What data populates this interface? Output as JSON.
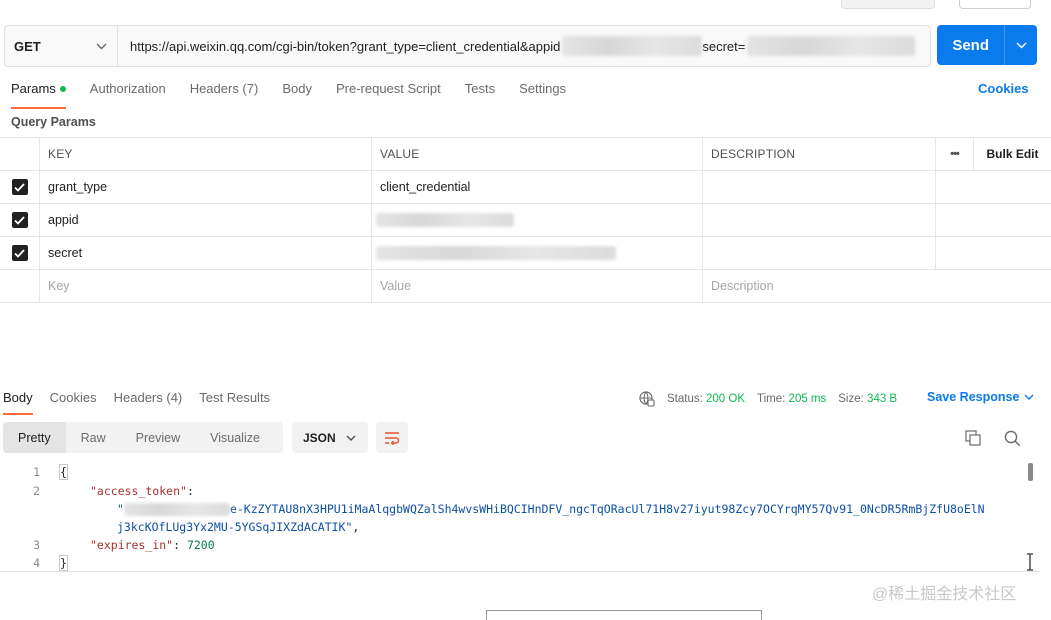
{
  "request": {
    "method": "GET",
    "url_prefix": "https://api.weixin.qq.com/cgi-bin/token?grant_type=client_credential&appid",
    "url_secret_label": "secret=",
    "send_label": "Send"
  },
  "request_tabs": [
    {
      "label": "Params",
      "active": true
    },
    {
      "label": "Authorization"
    },
    {
      "label": "Headers (7)"
    },
    {
      "label": "Body"
    },
    {
      "label": "Pre-request Script"
    },
    {
      "label": "Tests"
    },
    {
      "label": "Settings"
    }
  ],
  "cookies_label": "Cookies",
  "query_params_label": "Query Params",
  "params_table": {
    "headers": {
      "key": "KEY",
      "value": "VALUE",
      "description": "DESCRIPTION",
      "more": "•••",
      "bulk_edit": "Bulk Edit"
    },
    "rows": [
      {
        "key": "grant_type",
        "value": "client_credential"
      },
      {
        "key": "appid",
        "value": ""
      },
      {
        "key": "secret",
        "value": ""
      }
    ],
    "placeholders": {
      "key": "Key",
      "value": "Value",
      "description": "Description"
    }
  },
  "response_tabs": [
    {
      "label": "Body",
      "active": true
    },
    {
      "label": "Cookies"
    },
    {
      "label": "Headers (4)"
    },
    {
      "label": "Test Results"
    }
  ],
  "response_status": {
    "status_label": "Status:",
    "status_value": "200 OK",
    "time_label": "Time:",
    "time_value": "205 ms",
    "size_label": "Size:",
    "size_value": "343 B",
    "save_response": "Save Response"
  },
  "view_modes": [
    "Pretty",
    "Raw",
    "Preview",
    "Visualize"
  ],
  "format": "JSON",
  "code": {
    "line_numbers": [
      "1",
      "2",
      "3",
      "4"
    ],
    "open_brace": "{",
    "close_brace": "}",
    "key1": "\"access_token\"",
    "token_part1": "e-KzZYTAU8nX3HPU1iMaAlqgbWQZalSh4wvsWHiBQCIHnDFV_ngcTqORacUl71H8v27iyut98Zcy7OCYrqMY57Qv91_0NcDR5RmBjZfU8oElN",
    "token_part2": "j3kcKOfLUg3Yx2MU-5YGSqJIXZdACATIK\"",
    "key2": "\"expires_in\"",
    "expires_value": "7200"
  },
  "watermark": "@稀土掘金技术社区",
  "colors": {
    "accent": "#097bed",
    "tab_active": "#ff6c37",
    "status_ok": "#0cbb52"
  }
}
